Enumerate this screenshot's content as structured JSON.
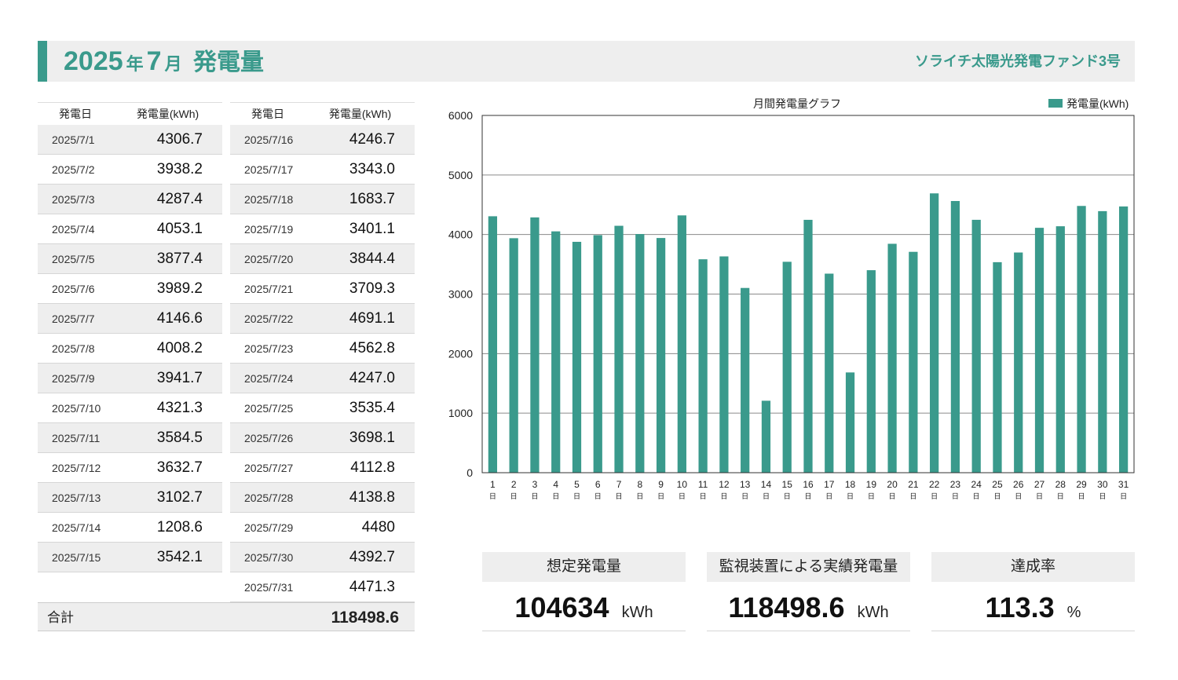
{
  "header": {
    "year": "2025",
    "year_suffix": "年",
    "month": "7",
    "month_suffix": "月",
    "title": "発電量",
    "fund_name": "ソライチ太陽光発電ファンド3号"
  },
  "table": {
    "col_date": "発電日",
    "col_value": "発電量(kWh)",
    "left_rows": [
      {
        "date": "2025/7/1",
        "value": "4306.7"
      },
      {
        "date": "2025/7/2",
        "value": "3938.2"
      },
      {
        "date": "2025/7/3",
        "value": "4287.4"
      },
      {
        "date": "2025/7/4",
        "value": "4053.1"
      },
      {
        "date": "2025/7/5",
        "value": "3877.4"
      },
      {
        "date": "2025/7/6",
        "value": "3989.2"
      },
      {
        "date": "2025/7/7",
        "value": "4146.6"
      },
      {
        "date": "2025/7/8",
        "value": "4008.2"
      },
      {
        "date": "2025/7/9",
        "value": "3941.7"
      },
      {
        "date": "2025/7/10",
        "value": "4321.3"
      },
      {
        "date": "2025/7/11",
        "value": "3584.5"
      },
      {
        "date": "2025/7/12",
        "value": "3632.7"
      },
      {
        "date": "2025/7/13",
        "value": "3102.7"
      },
      {
        "date": "2025/7/14",
        "value": "1208.6"
      },
      {
        "date": "2025/7/15",
        "value": "3542.1"
      }
    ],
    "right_rows": [
      {
        "date": "2025/7/16",
        "value": "4246.7"
      },
      {
        "date": "2025/7/17",
        "value": "3343.0"
      },
      {
        "date": "2025/7/18",
        "value": "1683.7"
      },
      {
        "date": "2025/7/19",
        "value": "3401.1"
      },
      {
        "date": "2025/7/20",
        "value": "3844.4"
      },
      {
        "date": "2025/7/21",
        "value": "3709.3"
      },
      {
        "date": "2025/7/22",
        "value": "4691.1"
      },
      {
        "date": "2025/7/23",
        "value": "4562.8"
      },
      {
        "date": "2025/7/24",
        "value": "4247.0"
      },
      {
        "date": "2025/7/25",
        "value": "3535.4"
      },
      {
        "date": "2025/7/26",
        "value": "3698.1"
      },
      {
        "date": "2025/7/27",
        "value": "4112.8"
      },
      {
        "date": "2025/7/28",
        "value": "4138.8"
      },
      {
        "date": "2025/7/29",
        "value": "4480"
      },
      {
        "date": "2025/7/30",
        "value": "4392.7"
      },
      {
        "date": "2025/7/31",
        "value": "4471.3"
      }
    ],
    "total_label": "合計",
    "total_value": "118498.6"
  },
  "summary": [
    {
      "label": "想定発電量",
      "value": "104634",
      "unit": "kWh"
    },
    {
      "label": "監視装置による実績発電量",
      "value": "118498.6",
      "unit": "kWh"
    },
    {
      "label": "達成率",
      "value": "113.3",
      "unit": "%"
    }
  ],
  "colors": {
    "accent": "#3a9a8c",
    "bar": "#3a9a8c",
    "shade": "#eeeeee"
  },
  "chart_data": {
    "type": "bar",
    "title": "月間発電量グラフ",
    "legend": "発電量(kWh)",
    "legend_position": "top-right",
    "ylim": [
      0,
      6000
    ],
    "yticks": [
      0,
      1000,
      2000,
      3000,
      4000,
      5000,
      6000
    ],
    "grid": true,
    "category_suffix": "日",
    "categories": [
      "1",
      "2",
      "3",
      "4",
      "5",
      "6",
      "7",
      "8",
      "9",
      "10",
      "11",
      "12",
      "13",
      "14",
      "15",
      "16",
      "17",
      "18",
      "19",
      "20",
      "21",
      "22",
      "23",
      "24",
      "25",
      "26",
      "27",
      "28",
      "29",
      "30",
      "31"
    ],
    "values": [
      4306.7,
      3938.2,
      4287.4,
      4053.1,
      3877.4,
      3989.2,
      4146.6,
      4008.2,
      3941.7,
      4321.3,
      3584.5,
      3632.7,
      3102.7,
      1208.6,
      3542.1,
      4246.7,
      3343.0,
      1683.7,
      3401.1,
      3844.4,
      3709.3,
      4691.1,
      4562.8,
      4247.0,
      3535.4,
      3698.1,
      4112.8,
      4138.8,
      4480,
      4392.7,
      4471.3
    ]
  }
}
